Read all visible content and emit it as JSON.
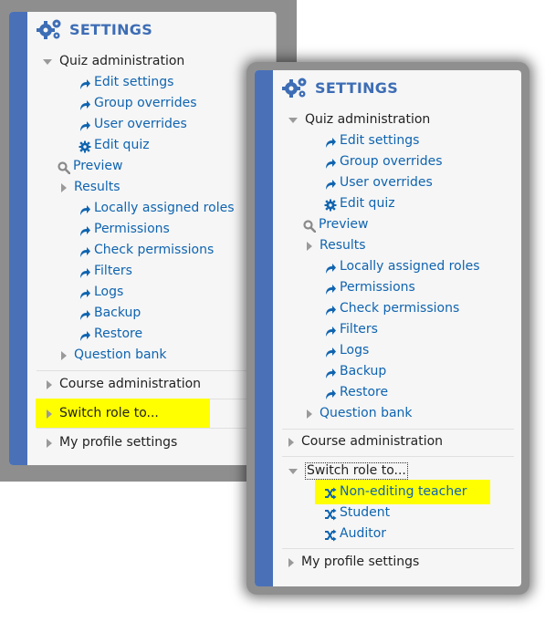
{
  "colors": {
    "accent": "#4a71b8",
    "link": "#0f64b0",
    "title": "#3d6db5",
    "highlight": "#ffff00"
  },
  "settings_title": "SETTINGS",
  "quiz_admin": {
    "label": "Quiz administration",
    "items": [
      {
        "label": "Edit settings",
        "icon": "redo-arrow-icon"
      },
      {
        "label": "Group overrides",
        "icon": "redo-arrow-icon"
      },
      {
        "label": "User overrides",
        "icon": "redo-arrow-icon"
      },
      {
        "label": "Edit quiz",
        "icon": "gear-icon"
      },
      {
        "label": "Preview",
        "icon": "magnifier-icon"
      },
      {
        "label": "Results",
        "icon": "expand-triangle"
      },
      {
        "label": "Locally assigned roles",
        "icon": "redo-arrow-icon"
      },
      {
        "label": "Permissions",
        "icon": "redo-arrow-icon"
      },
      {
        "label": "Check permissions",
        "icon": "redo-arrow-icon"
      },
      {
        "label": "Filters",
        "icon": "redo-arrow-icon"
      },
      {
        "label": "Logs",
        "icon": "redo-arrow-icon"
      },
      {
        "label": "Backup",
        "icon": "redo-arrow-icon"
      },
      {
        "label": "Restore",
        "icon": "redo-arrow-icon"
      },
      {
        "label": "Question bank",
        "icon": "expand-triangle"
      }
    ]
  },
  "course_admin": "Course administration",
  "switch_role": {
    "label": "Switch role to...",
    "roles": [
      {
        "label": "Non-editing teacher",
        "icon": "shuffle-icon"
      },
      {
        "label": "Student",
        "icon": "shuffle-icon"
      },
      {
        "label": "Auditor",
        "icon": "shuffle-icon"
      }
    ]
  },
  "profile_settings": "My profile settings"
}
